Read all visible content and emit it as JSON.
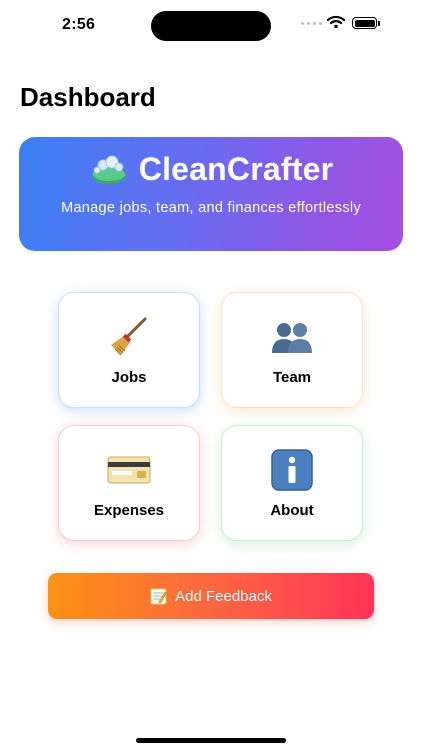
{
  "status_bar": {
    "time": "2:56",
    "icons": [
      "cellular-signal-icon",
      "wifi-icon",
      "battery-icon"
    ]
  },
  "page": {
    "title": "Dashboard"
  },
  "banner": {
    "icon": "soap-bubbles-icon",
    "title": "CleanCrafter",
    "subtitle": "Manage jobs, team, and finances effortlessly",
    "gradient": [
      "#3a7ff5",
      "#a54fe0"
    ]
  },
  "cards": [
    {
      "label": "Jobs",
      "icon": "broom-icon",
      "accent": "#4a89f0"
    },
    {
      "label": "Team",
      "icon": "people-icon",
      "accent": "#f4a850"
    },
    {
      "label": "Expenses",
      "icon": "credit-card-icon",
      "accent": "#ee5a62"
    },
    {
      "label": "About",
      "icon": "info-icon",
      "accent": "#58c470"
    }
  ],
  "feedback_button": {
    "label": "Add Feedback",
    "icon": "memo-icon",
    "gradient": [
      "#fb9212",
      "#ff3358"
    ]
  }
}
